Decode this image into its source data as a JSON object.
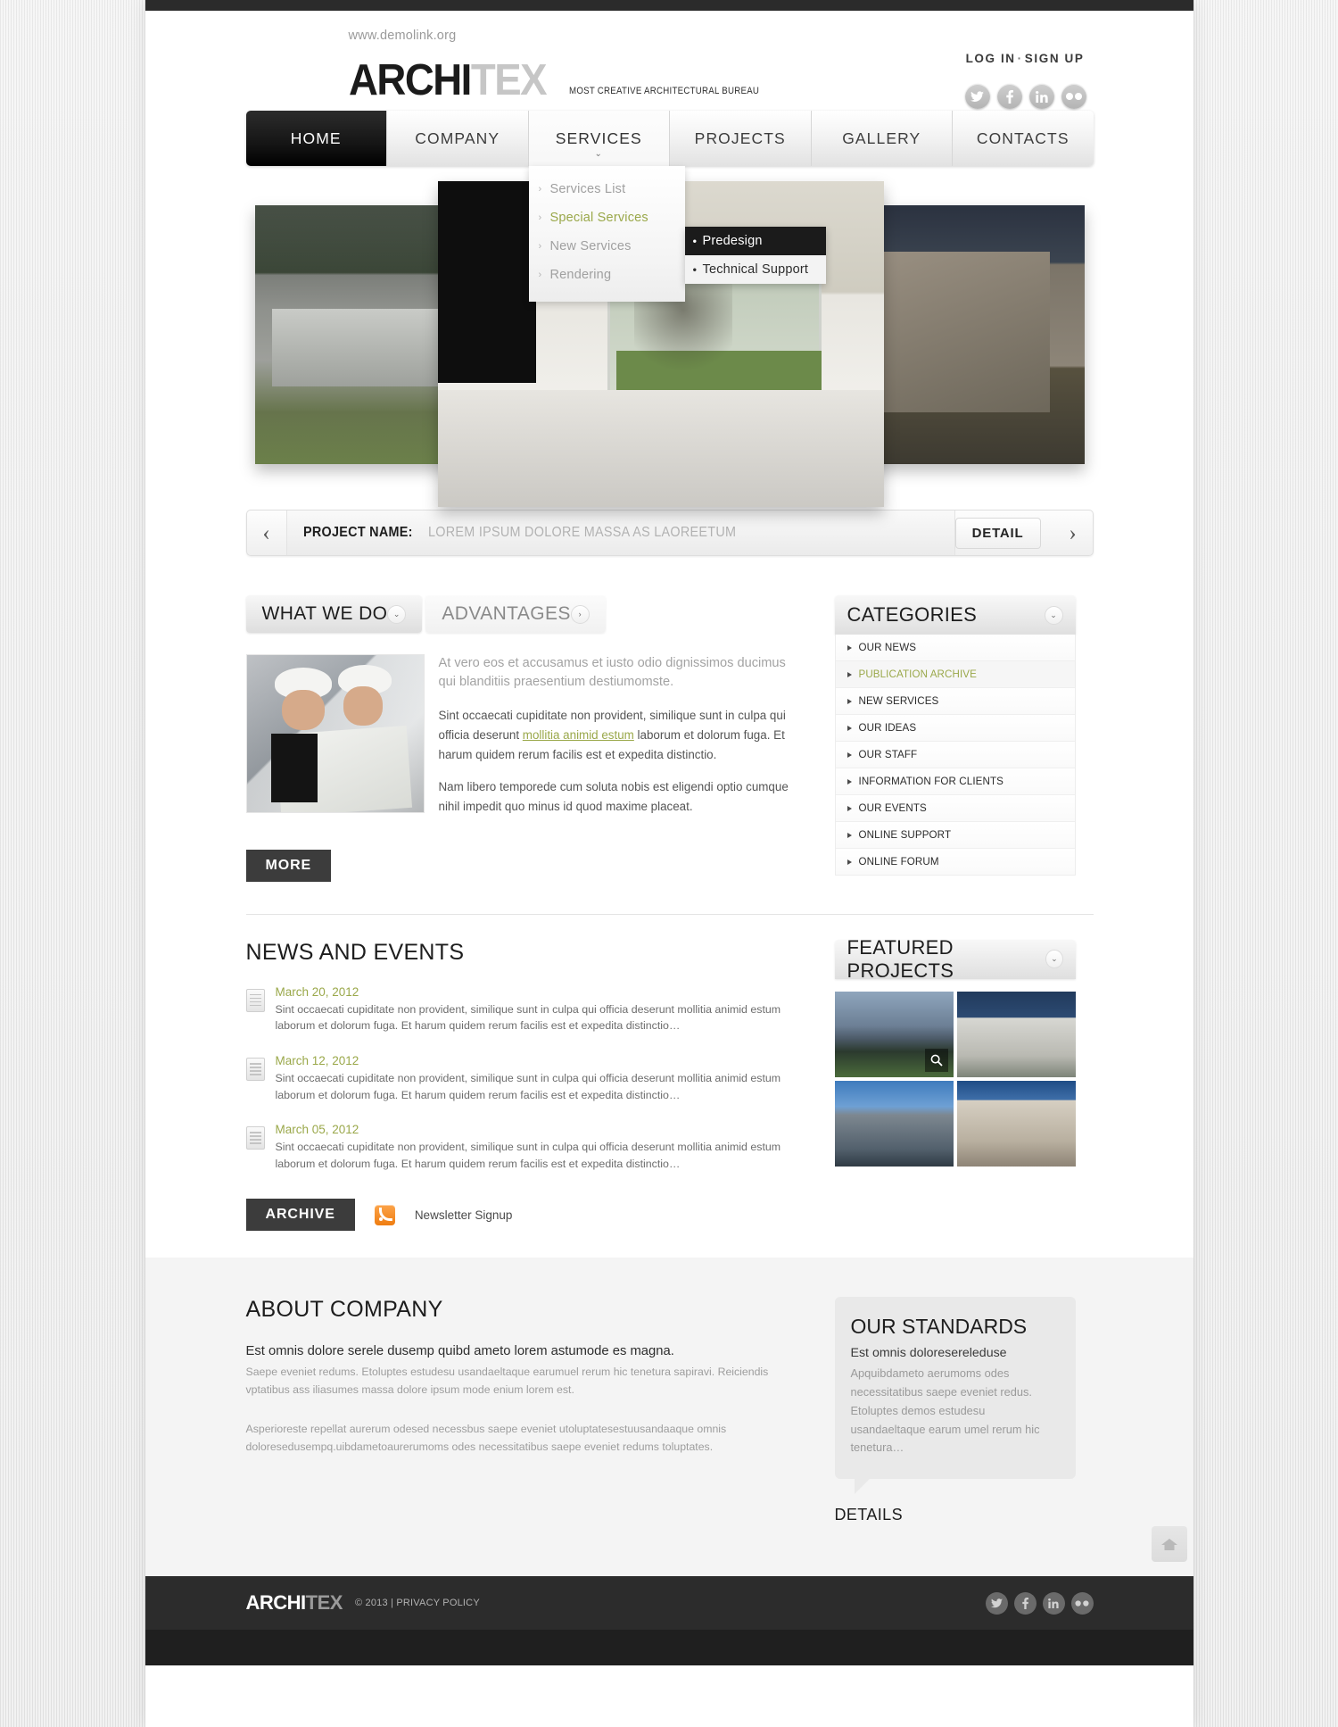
{
  "site": {
    "demolink": "www.demolink.org",
    "logo_dark": "ARCHI",
    "logo_light": "TEX",
    "tagline": "MOST CREATIVE ARCHITECTURAL BUREAU"
  },
  "auth": {
    "login": "LOG IN",
    "separator": "·",
    "signup": "SIGN UP"
  },
  "social": [
    {
      "name": "twitter-icon",
      "glyph": "t"
    },
    {
      "name": "facebook-icon",
      "glyph": "f"
    },
    {
      "name": "linkedin-icon",
      "glyph": "in"
    },
    {
      "name": "flickr-icon",
      "glyph": "••"
    }
  ],
  "nav": {
    "items": [
      {
        "label": "HOME",
        "state": "active"
      },
      {
        "label": "COMPANY",
        "state": "normal"
      },
      {
        "label": "SERVICES",
        "state": "open"
      },
      {
        "label": "PROJECTS",
        "state": "normal"
      },
      {
        "label": "GALLERY",
        "state": "normal"
      },
      {
        "label": "CONTACTS",
        "state": "normal"
      }
    ],
    "dropdown": [
      {
        "label": "Services List",
        "highlighted": false
      },
      {
        "label": "Special Services",
        "highlighted": true
      },
      {
        "label": "New Services",
        "highlighted": false
      },
      {
        "label": "Rendering",
        "highlighted": false
      }
    ],
    "submenu": [
      {
        "label": "Predesign",
        "style": "dark"
      },
      {
        "label": "Technical Support",
        "style": "light"
      }
    ]
  },
  "project_bar": {
    "prev_icon": "‹",
    "next_icon": "›",
    "label": "PROJECT NAME:",
    "value": "LOREM IPSUM DOLORE MASSA AS LAOREETUM",
    "detail_label": "DETAIL"
  },
  "tabs": [
    {
      "label": "WHAT WE DO",
      "state": "active",
      "knob": "⌄"
    },
    {
      "label": "ADVANTAGES",
      "state": "inactive",
      "knob": "›"
    }
  ],
  "what_we_do": {
    "lead": "At vero eos et accusamus et iusto odio dignissimos ducimus qui blanditiis praesentium destiumomste.",
    "para1_before": "Sint occaecati cupiditate non provident, similique sunt in culpa qui officia deserunt ",
    "para1_link": "mollitia animid estum",
    "para1_after": " laborum et dolorum fuga. Et harum quidem rerum facilis est et expedita distinctio.",
    "para2": "Nam libero temporede cum soluta nobis est eligendi optio cumque nihil impedit quo minus id quod maxime placeat.",
    "more_label": "MORE"
  },
  "categories": {
    "title": "CATEGORIES",
    "knob": "⌄",
    "items": [
      {
        "label": "OUR NEWS",
        "highlighted": false
      },
      {
        "label": "PUBLICATION ARCHIVE",
        "highlighted": true
      },
      {
        "label": "NEW SERVICES",
        "highlighted": false
      },
      {
        "label": "OUR IDEAS",
        "highlighted": false
      },
      {
        "label": "OUR STAFF",
        "highlighted": false
      },
      {
        "label": "INFORMATION FOR CLIENTS",
        "highlighted": false
      },
      {
        "label": "OUR EVENTS",
        "highlighted": false
      },
      {
        "label": "ONLINE SUPPORT",
        "highlighted": false
      },
      {
        "label": "ONLINE FORUM",
        "highlighted": false
      }
    ]
  },
  "news": {
    "title": "NEWS AND EVENTS",
    "items": [
      {
        "date": "March 20, 2012",
        "text": "Sint occaecati cupiditate non provident, similique sunt in culpa qui officia deserunt mollitia animid estum laborum et dolorum fuga. Et harum quidem rerum facilis est et expedita distinctio…"
      },
      {
        "date": "March 12, 2012",
        "text": "Sint occaecati cupiditate non provident, similique sunt in culpa qui officia deserunt mollitia animid estum laborum et dolorum fuga. Et harum quidem rerum facilis est et expedita distinctio…"
      },
      {
        "date": "March 05, 2012",
        "text": "Sint occaecati cupiditate non provident, similique sunt in culpa qui officia deserunt mollitia animid estum laborum et dolorum fuga. Et harum quidem rerum facilis est et expedita distinctio…"
      }
    ],
    "archive_label": "ARCHIVE",
    "newsletter_label": "Newsletter Signup"
  },
  "featured": {
    "title": "FEATURED PROJECTS",
    "knob": "⌄",
    "thumbs": [
      {
        "name": "featured-project-1",
        "has_zoom": true
      },
      {
        "name": "featured-project-2",
        "has_zoom": false
      },
      {
        "name": "featured-project-3",
        "has_zoom": false
      },
      {
        "name": "featured-project-4",
        "has_zoom": false
      }
    ]
  },
  "about": {
    "title": "ABOUT COMPANY",
    "lead": "Est omnis dolore serele dusemp quibd ameto lorem astumode es magna.",
    "small": "Saepe eveniet redums. Etoluptes estudesu usandaeltaque earumuel rerum hic tenetura sapiravi. Reiciendis vptatibus ass iliasumes massa dolore ipsum mode enium lorem est.",
    "small2": "Asperioreste repellat aurerum odesed necessbus saepe eveniet utoluptatesestuusandaaque omnis doloresedusempq.uibdametoaurerumoms odes necessitatibus saepe eveniet redums toluptates."
  },
  "standards": {
    "title": "OUR STANDARDS",
    "lead": "Est omnis doloresereleduse",
    "text": "Apquibdameto aerumoms odes necessitatibus saepe eveniet redus. Etoluptes demos estudesu usandaeltaque earum umel rerum hic tenetura…",
    "details_label": "DETAILS"
  },
  "footer": {
    "logo_dark": "ARCHI",
    "logo_light": "TEX",
    "copyright": "© 2013 | PRIVACY POLICY",
    "social": [
      {
        "name": "twitter-icon",
        "glyph": "t"
      },
      {
        "name": "facebook-icon",
        "glyph": "f"
      },
      {
        "name": "linkedin-icon",
        "glyph": "in"
      },
      {
        "name": "flickr-icon",
        "glyph": "••"
      }
    ]
  },
  "colors": {
    "accent": "#9aa84a",
    "dark": "#2c2c2c",
    "rss_orange": "#ef7d11"
  }
}
